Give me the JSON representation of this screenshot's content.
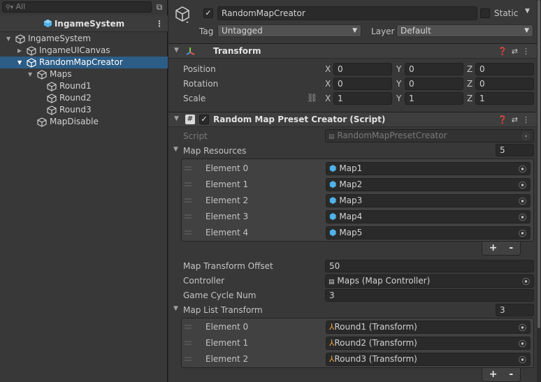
{
  "hierarchy": {
    "search_placeholder": "All",
    "scene_name": "IngameSystem",
    "items": [
      {
        "label": "IngameSystem"
      },
      {
        "label": "IngameUICanvas"
      },
      {
        "label": "RandomMapCreator"
      },
      {
        "label": "Maps"
      },
      {
        "label": "Round1"
      },
      {
        "label": "Round2"
      },
      {
        "label": "Round3"
      },
      {
        "label": "MapDisable"
      }
    ]
  },
  "inspector": {
    "object_name": "RandomMapCreator",
    "static_label": "Static",
    "tag_label": "Tag",
    "tag_value": "Untagged",
    "layer_label": "Layer",
    "layer_value": "Default",
    "transform": {
      "title": "Transform",
      "rows": [
        {
          "label": "Position",
          "x": "0",
          "y": "0",
          "z": "0"
        },
        {
          "label": "Rotation",
          "x": "0",
          "y": "0",
          "z": "0"
        },
        {
          "label": "Scale",
          "x": "1",
          "y": "1",
          "z": "1"
        }
      ],
      "axis_x": "X",
      "axis_y": "Y",
      "axis_z": "Z"
    },
    "script_comp": {
      "title": "Random Map Preset Creator (Script)",
      "script_label": "Script",
      "script_value": "RandomMapPresetCreator",
      "map_resources_label": "Map Resources",
      "map_resources_count": "5",
      "map_elements": [
        {
          "label": "Element 0",
          "value": "Map1"
        },
        {
          "label": "Element 1",
          "value": "Map2"
        },
        {
          "label": "Element 2",
          "value": "Map3"
        },
        {
          "label": "Element 3",
          "value": "Map4"
        },
        {
          "label": "Element 4",
          "value": "Map5"
        }
      ],
      "offset_label": "Map Transform Offset",
      "offset_value": "50",
      "controller_label": "Controller",
      "controller_value": "Maps (Map Controller)",
      "cycle_label": "Game Cycle Num",
      "cycle_value": "3",
      "list_label": "Map List Transform",
      "list_count": "3",
      "list_elements": [
        {
          "label": "Element 0",
          "value": "Round1 (Transform)"
        },
        {
          "label": "Element 1",
          "value": "Round2 (Transform)"
        },
        {
          "label": "Element 2",
          "value": "Round3 (Transform)"
        }
      ],
      "plus": "+",
      "minus": "-"
    }
  },
  "colors": {
    "selection": "#2c5d87",
    "panel": "#383838",
    "field": "#2a2a2a"
  }
}
